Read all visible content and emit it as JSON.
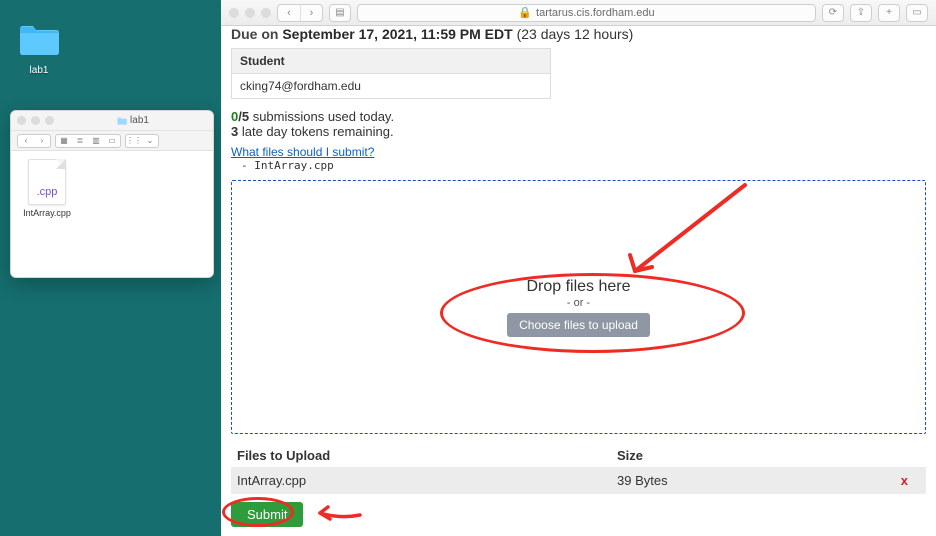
{
  "desktop": {
    "folder_label": "lab1"
  },
  "finder": {
    "title": "lab1",
    "file_name": "IntArray.cpp",
    "file_ext": ".cpp"
  },
  "safari": {
    "url": "tartarus.cis.fordham.edu"
  },
  "page": {
    "due_prefix": "Due on",
    "due_date": "September 17, 2021, 11:59 PM EDT",
    "due_suffix": "(23 days 12 hours)",
    "student_header": "Student",
    "student_value": "cking74@fordham.edu",
    "submissions_used": "0",
    "submissions_total": "/5",
    "submissions_suffix": " submissions used today.",
    "late_tokens_count": "3",
    "late_tokens_suffix": " late day tokens remaining.",
    "help_link": "What files should I submit?",
    "expected_file_prefix": "- ",
    "expected_file": "IntArray.cpp",
    "dropzone_title": "Drop files here",
    "dropzone_or": "- or -",
    "choose_btn": "Choose files to upload",
    "table_head_file": "Files to Upload",
    "table_head_size": "Size",
    "row_file": "IntArray.cpp",
    "row_size": "39 Bytes",
    "row_delete": "x",
    "submit_label": "Submit"
  },
  "colors": {
    "desktop_bg": "#166e6e",
    "accent_blue": "#1a49d6",
    "submit_green": "#2e9c3a",
    "annot_red": "#ee2b24"
  }
}
